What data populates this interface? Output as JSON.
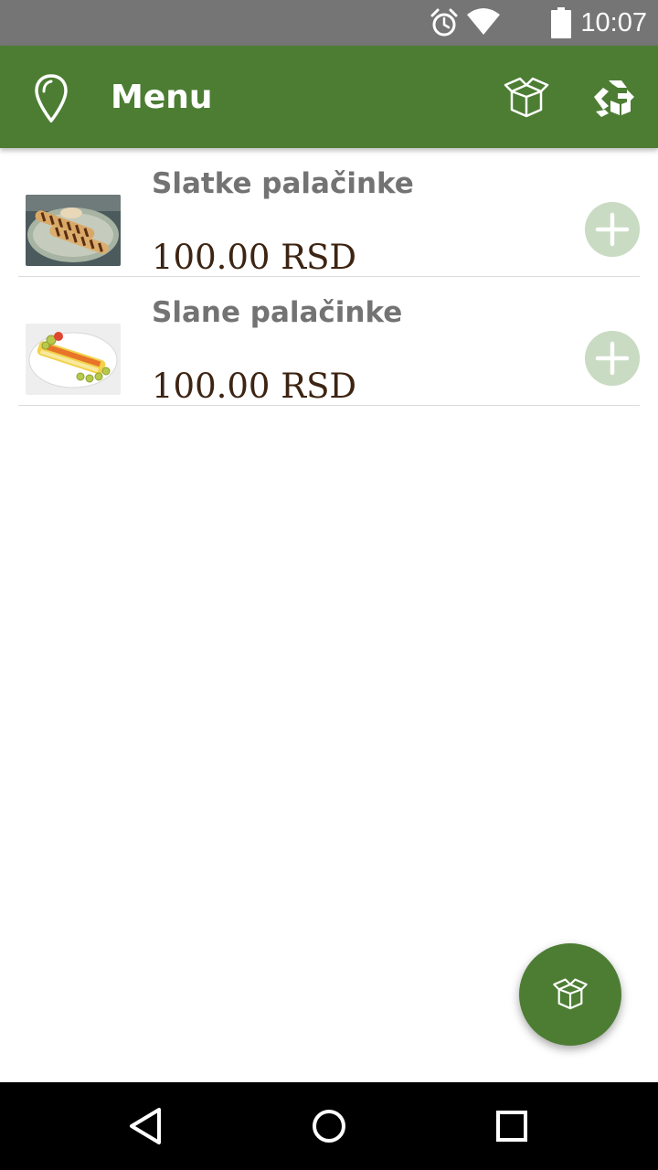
{
  "status_bar": {
    "time": "10:07",
    "icons": [
      "alarm-icon",
      "wifi-icon",
      "battery-icon"
    ]
  },
  "app_bar": {
    "title": "Menu",
    "left_icon": "location-pin-icon",
    "right_icons": [
      "open-box-icon",
      "box-exchange-icon"
    ]
  },
  "menu": {
    "items": [
      {
        "name": "Slatke palačinke",
        "price": "100.00 RSD",
        "image_icon": "sweet-crepes-photo",
        "action_icon": "add-icon"
      },
      {
        "name": "Slane palačinke",
        "price": "100.00 RSD",
        "image_icon": "savory-crepes-photo",
        "action_icon": "add-icon"
      }
    ]
  },
  "fab": {
    "icon": "open-box-icon"
  },
  "nav_bar": {
    "buttons": [
      "back-icon",
      "home-icon",
      "recents-icon"
    ]
  },
  "colors": {
    "primary": "#4c7d33",
    "status_bar": "#757575",
    "add_button": "#c9dbc3",
    "item_name": "#737373",
    "price": "#3d2412"
  }
}
